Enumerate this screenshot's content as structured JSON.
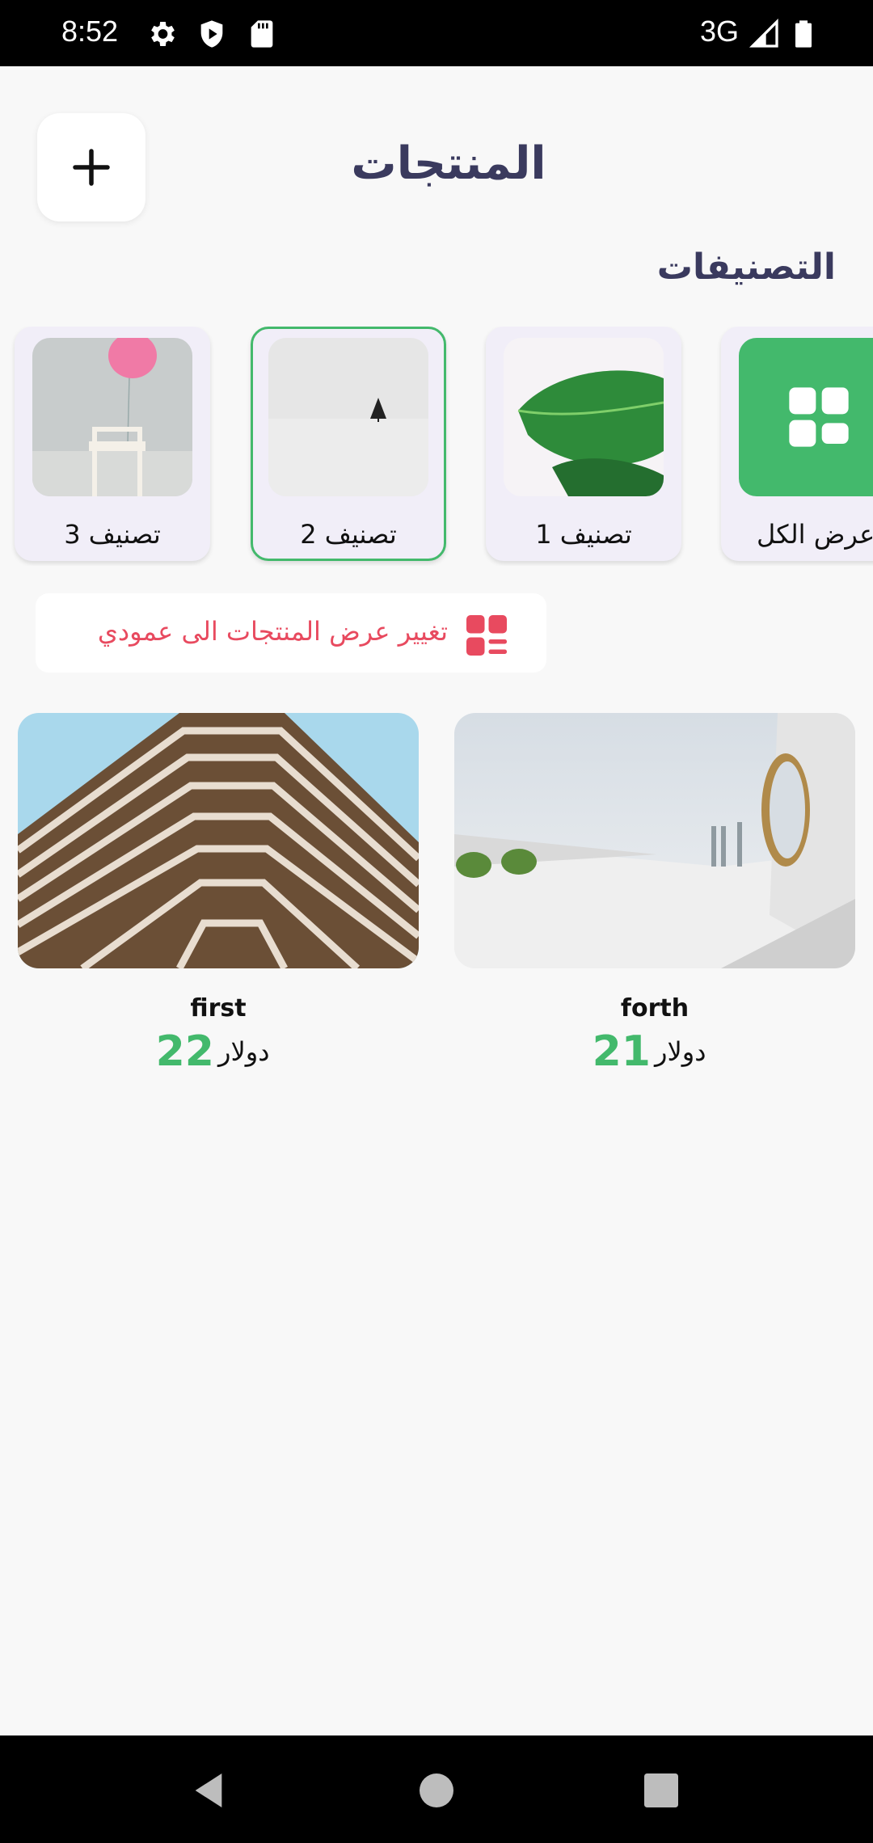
{
  "status_bar": {
    "time": "8:52",
    "network": "3G"
  },
  "header": {
    "title": "المنتجات"
  },
  "categories": {
    "title": "التصنيفات",
    "items": [
      {
        "label": "عرض الكل",
        "selected": false,
        "icon": "grid-icon"
      },
      {
        "label": "تصنيف 1",
        "selected": false
      },
      {
        "label": "تصنيف 2",
        "selected": true
      },
      {
        "label": "تصنيف 3",
        "selected": false
      }
    ]
  },
  "view_toggle": {
    "label": "تغيير عرض المنتجات الى عمودي",
    "icon": "list-view-icon"
  },
  "products": [
    {
      "name": "forth",
      "price": "21",
      "currency": "دولار"
    },
    {
      "name": "first",
      "price": "22",
      "currency": "دولار"
    }
  ],
  "colors": {
    "accent": "#43b96c",
    "title": "#3a3a5e",
    "alert": "#e84a5f"
  }
}
